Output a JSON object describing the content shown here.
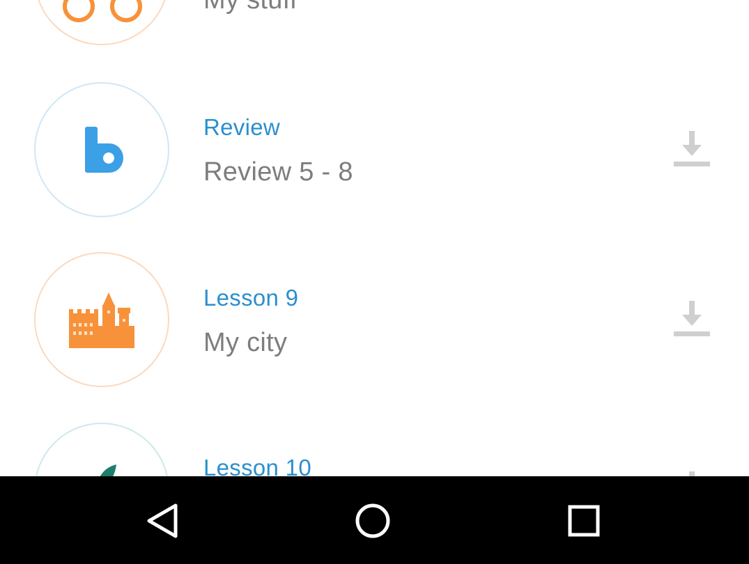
{
  "lessons": [
    {
      "title": "",
      "subtitle": "My stuff",
      "icon": "glasses-icon",
      "icon_color": "#f7923a",
      "action_icon": "download-icon"
    },
    {
      "title": "Review",
      "subtitle": "Review 5 - 8",
      "icon": "babbel-b-icon",
      "icon_color": "#3ba0e6",
      "action_icon": "download-icon"
    },
    {
      "title": "Lesson 9",
      "subtitle": "My city",
      "icon": "city-buildings-icon",
      "icon_color": "#f7923a",
      "action_icon": "download-icon"
    },
    {
      "title": "Lesson 10",
      "subtitle": "",
      "icon": "leaf-icon",
      "icon_color": "#1f7d6e",
      "action_icon": "download-icon"
    }
  ],
  "colors": {
    "title": "#2b8fce",
    "subtitle": "#7d7d7d",
    "download_icon": "#cfcfcf",
    "navbar": "#000000"
  },
  "navbar": {
    "buttons": [
      "back-icon",
      "home-icon",
      "recents-icon"
    ]
  }
}
